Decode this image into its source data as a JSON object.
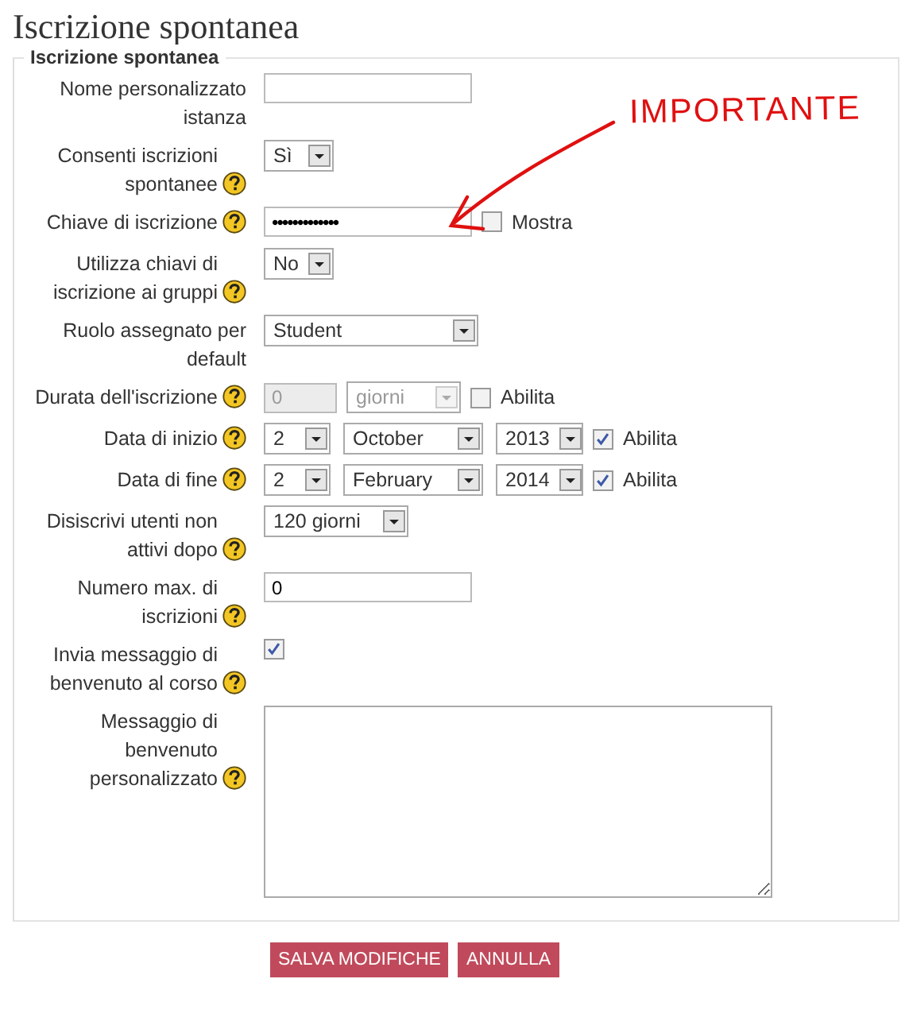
{
  "page_title": "Iscrizione spontanea",
  "section": {
    "legend": "Iscrizione spontanea",
    "fields": [
      {
        "kind": "text",
        "label": "Nome personalizzato istanza",
        "help": false
      },
      {
        "kind": "select",
        "label": "Consenti iscrizioni spontanee",
        "help": true,
        "value": "Sì"
      },
      {
        "kind": "password",
        "label": "Chiave di iscrizione",
        "help": true,
        "value": "•••••••••••••",
        "option": {
          "label": "Mostra",
          "checked": false
        }
      },
      {
        "kind": "select",
        "label": "Utilizza chiavi di iscrizione ai gruppi",
        "help": true,
        "value": "No"
      },
      {
        "kind": "select",
        "label": "Ruolo assegnato per default",
        "help": false,
        "value": "Student"
      },
      {
        "kind": "duration",
        "label": "Durata dell'iscrizione",
        "help": true,
        "value": "0",
        "unit": "giorni",
        "disabled": true,
        "option": {
          "label": "Abilita",
          "checked": false
        }
      },
      {
        "kind": "date",
        "label": "Data di inizio",
        "help": true,
        "day": "2",
        "month": "October",
        "year": "2013",
        "option": {
          "label": "Abilita",
          "checked": true
        }
      },
      {
        "kind": "date",
        "label": "Data di fine",
        "help": true,
        "day": "2",
        "month": "February",
        "year": "2014",
        "option": {
          "label": "Abilita",
          "checked": true
        }
      },
      {
        "kind": "select",
        "label": "Disiscrivi utenti non attivi dopo",
        "help": true,
        "value": "120 giorni"
      },
      {
        "kind": "text",
        "label": "Numero max. di iscrizioni",
        "help": true,
        "value": "0"
      },
      {
        "kind": "checkbox",
        "label": "Invia messaggio di benvenuto al corso",
        "help": true,
        "checked": true
      },
      {
        "kind": "textarea",
        "label": "Messaggio di benvenuto personalizzato",
        "help": true
      }
    ]
  },
  "annotation": {
    "text": "IMPORTANTE"
  },
  "buttons": [
    {
      "label": "SALVA MODIFICHE"
    },
    {
      "label": "ANNULLA"
    }
  ]
}
